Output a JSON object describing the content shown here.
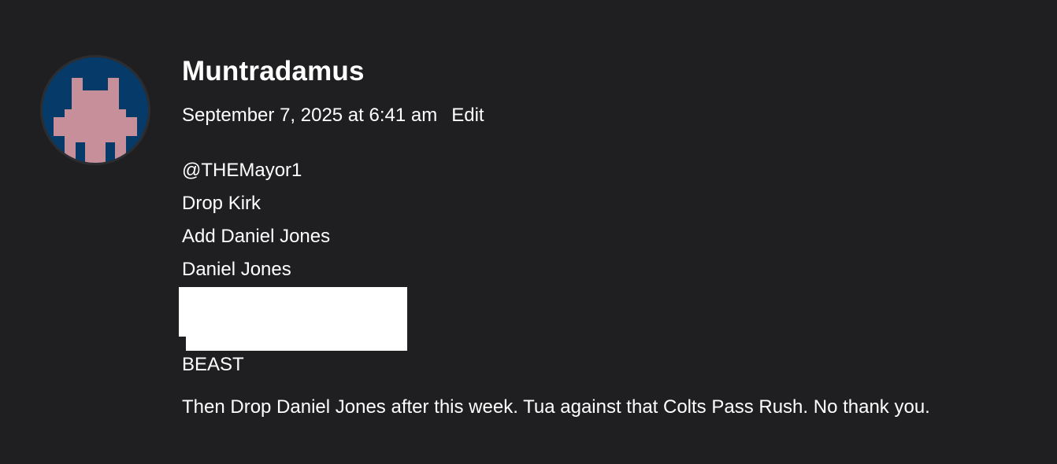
{
  "comment": {
    "author": "Muntradamus",
    "timestamp": "September 7, 2025 at 6:41 am",
    "edit_label": "Edit",
    "lines": [
      "@THEMayor1",
      "Drop Kirk",
      "Add Daniel Jones",
      "Daniel Jones"
    ],
    "after_redaction": "BEAST",
    "final_text": "Then Drop Daniel Jones after this week. Tua against that Colts Pass Rush. No thank you."
  },
  "colors": {
    "background": "#1f1f21",
    "avatar_background": "#063a68",
    "avatar_sprite": "#c78f99",
    "text": "#ffffff",
    "redaction": "#ffffff"
  },
  "icons": {
    "avatar": "pixel-invader-icon"
  }
}
